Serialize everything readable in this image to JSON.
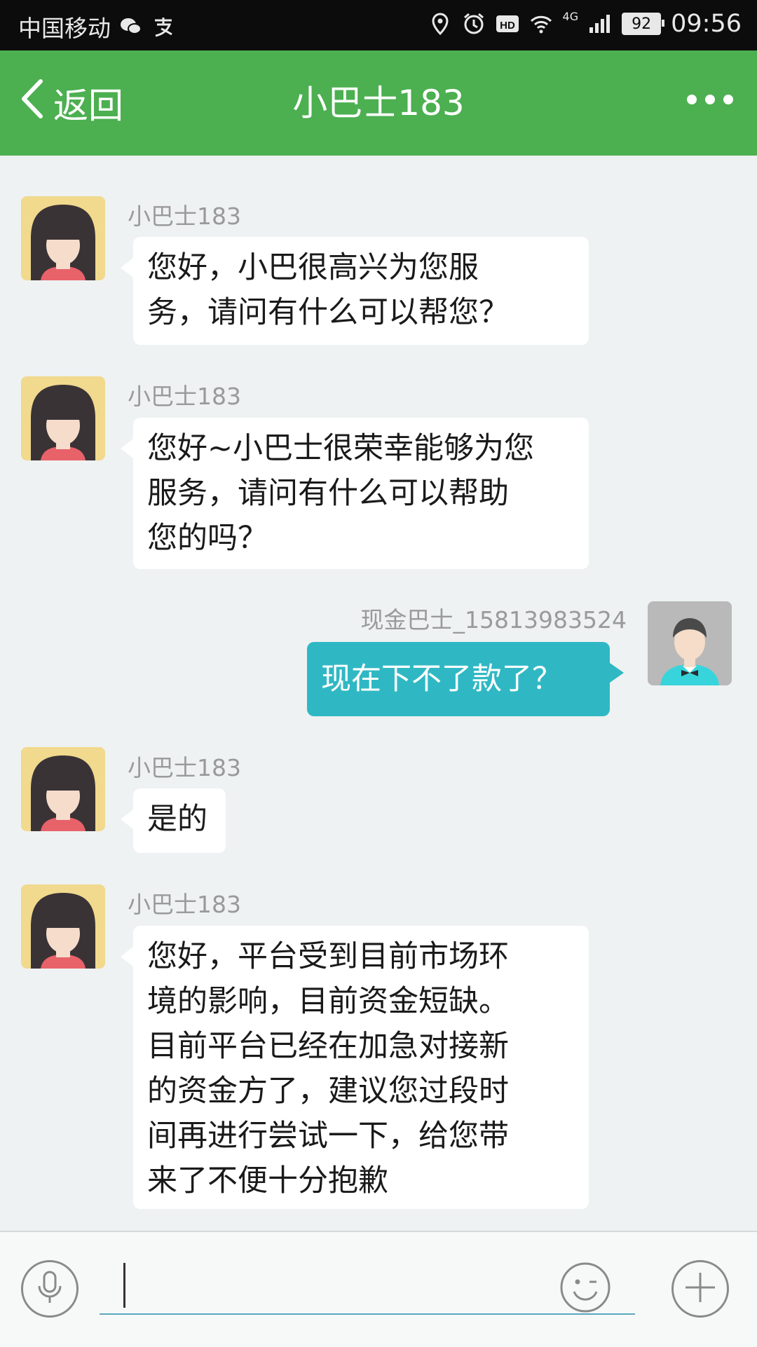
{
  "status_bar": {
    "carrier": "中国移动",
    "network": "4G",
    "battery": "92",
    "time": "09:56"
  },
  "header": {
    "back_label": "返回",
    "title": "小巴士183"
  },
  "messages": [
    {
      "side": "left",
      "sender": "小巴士183",
      "lines": [
        "您好，小巴很高兴为您服",
        "务，请问有什么可以帮您？"
      ]
    },
    {
      "side": "left",
      "sender": "小巴士183",
      "lines": [
        "您好~小巴士很荣幸能够为您",
        "服务，请问有什么可以帮助",
        "您的吗？"
      ]
    },
    {
      "side": "right",
      "sender": "现金巴士_15813983524",
      "lines": [
        "现在下不了款了？"
      ]
    },
    {
      "side": "left",
      "sender": "小巴士183",
      "lines": [
        "是的"
      ]
    },
    {
      "side": "left",
      "sender": "小巴士183",
      "lines": [
        "您好，平台受到目前市场环",
        "境的影响，目前资金短缺。",
        "目前平台已经在加急对接新",
        "的资金方了，建议您过段时",
        "间再进行尝试一下，给您带",
        "来了不便十分抱歉"
      ]
    }
  ],
  "input": {
    "value": "",
    "placeholder": ""
  },
  "colors": {
    "header": "#4caf50",
    "outgoing_bubble": "#2fb8c4",
    "incoming_bubble": "#ffffff",
    "background": "#eef2f2"
  },
  "icons": {
    "voice": "microphone-icon",
    "emoji": "emoji-icon",
    "more": "plus-icon"
  }
}
